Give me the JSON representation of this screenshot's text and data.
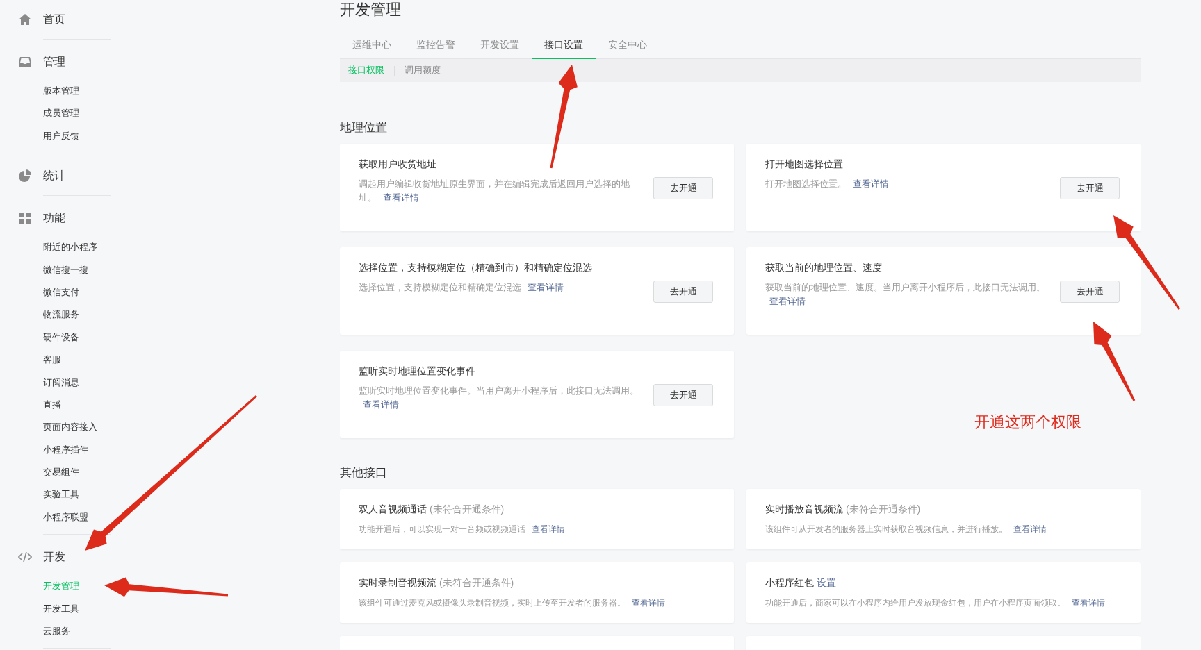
{
  "sidebar": {
    "sections": [
      {
        "kind": "home",
        "label": "首页"
      },
      {
        "kind": "inbox",
        "label": "管理",
        "items": [
          {
            "label": "版本管理",
            "selected": false
          },
          {
            "label": "成员管理",
            "selected": false
          },
          {
            "label": "用户反馈",
            "selected": false
          }
        ]
      },
      {
        "kind": "pie",
        "label": "统计"
      },
      {
        "kind": "grid",
        "label": "功能",
        "items": [
          {
            "label": "附近的小程序",
            "selected": false
          },
          {
            "label": "微信搜一搜",
            "selected": false
          },
          {
            "label": "微信支付",
            "selected": false
          },
          {
            "label": "物流服务",
            "selected": false
          },
          {
            "label": "硬件设备",
            "selected": false
          },
          {
            "label": "客服",
            "selected": false
          },
          {
            "label": "订阅消息",
            "selected": false
          },
          {
            "label": "直播",
            "selected": false
          },
          {
            "label": "页面内容接入",
            "selected": false
          },
          {
            "label": "小程序插件",
            "selected": false
          },
          {
            "label": "交易组件",
            "selected": false
          },
          {
            "label": "实验工具",
            "selected": false
          },
          {
            "label": "小程序联盟",
            "selected": false
          }
        ]
      },
      {
        "kind": "code",
        "label": "开发",
        "items": [
          {
            "label": "开发管理",
            "selected": true
          },
          {
            "label": "开发工具",
            "selected": false
          },
          {
            "label": "云服务",
            "selected": false
          }
        ]
      }
    ]
  },
  "page_title": "开发管理",
  "tabs": [
    {
      "label": "运维中心",
      "selected": false
    },
    {
      "label": "监控告警",
      "selected": false
    },
    {
      "label": "开发设置",
      "selected": false
    },
    {
      "label": "接口设置",
      "selected": true
    },
    {
      "label": "安全中心",
      "selected": false
    }
  ],
  "subtabs": [
    {
      "label": "接口权限",
      "selected": true
    },
    {
      "label": "调用额度",
      "selected": false
    }
  ],
  "sections": [
    {
      "title": "地理位置",
      "cards": [
        {
          "title": "获取用户收货地址",
          "description": "调起用户编辑收货地址原生界面，并在编辑完成后返回用户选择的地址。",
          "link": "查看详情",
          "button": "去开通"
        },
        {
          "title": "打开地图选择位置",
          "description": "打开地图选择位置。",
          "link": "查看详情",
          "button": "去开通"
        },
        {
          "title": "选择位置，支持模糊定位（精确到市）和精确定位混选",
          "description": "选择位置，支持模糊定位和精确定位混选",
          "link": "查看详情",
          "button": "去开通"
        },
        {
          "title": "获取当前的地理位置、速度",
          "description": "获取当前的地理位置、速度。当用户离开小程序后，此接口无法调用。",
          "link": "查看详情",
          "button": "去开通"
        },
        {
          "title": "监听实时地理位置变化事件",
          "description": "监听实时地理位置变化事件。当用户离开小程序后，此接口无法调用。",
          "link": "查看详情",
          "button": "去开通"
        }
      ]
    },
    {
      "title": "其他接口",
      "cards": [
        {
          "title": "双人音视频通话",
          "title_note": "(未符合开通条件)",
          "description": "功能开通后，可以实现一对一音频或视频通话",
          "link": "查看详情"
        },
        {
          "title": "实时播放音视频流",
          "title_note": "(未符合开通条件)",
          "description": "该组件可从开发者的服务器上实时获取音视频信息，并进行播放。",
          "link": "查看详情"
        },
        {
          "title": "实时录制音视频流",
          "title_note": "(未符合开通条件)",
          "description": "该组件可通过麦克风或摄像头录制音视频，实时上传至开发者的服务器。",
          "link": "查看详情"
        },
        {
          "title": "小程序红包",
          "title_link": "设置",
          "description": "功能开通后，商家可以在小程序内给用户发放现金红包，用户在小程序页面领取。",
          "link": "查看详情"
        }
      ]
    }
  ],
  "annotation": {
    "text": "开通这两个权限"
  }
}
